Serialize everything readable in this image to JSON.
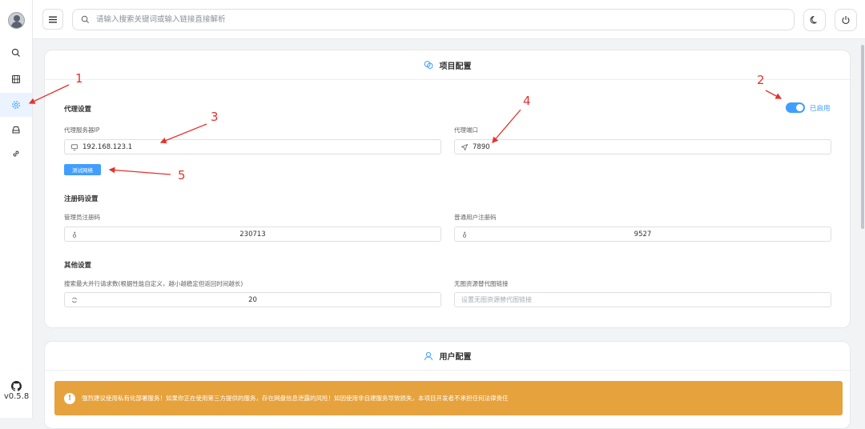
{
  "header": {
    "search_placeholder": "请输入搜索关键词或输入链接直接解析"
  },
  "sidebar": {
    "items": [
      {
        "icon": "search-icon"
      },
      {
        "icon": "film-icon"
      },
      {
        "icon": "gear-icon",
        "active": true
      },
      {
        "icon": "drive-icon"
      },
      {
        "icon": "link-icon"
      }
    ],
    "version": "v0.5.8"
  },
  "project_config": {
    "title": "项目配置",
    "proxy": {
      "section_title": "代理设置",
      "enabled_label": "已启用",
      "enabled": true,
      "ip_label": "代理服务器IP",
      "ip_value": "192.168.123.1",
      "port_label": "代理端口",
      "port_value": "7890",
      "test_button": "测试网络"
    },
    "register": {
      "section_title": "注册码设置",
      "admin_label": "管理员注册码",
      "admin_value": "230713",
      "user_label": "普通用户注册码",
      "user_value": "9527"
    },
    "other": {
      "section_title": "其他设置",
      "concurrency_label": "搜索最大并行请求数(根据性能自定义，越小越稳定但返回时间越长)",
      "concurrency_value": "20",
      "image_proxy_label": "无图资源替代图链接",
      "image_proxy_placeholder": "设置无图资源替代图链接"
    }
  },
  "user_config": {
    "title": "用户配置",
    "alert_icon": "!",
    "alert_text": "强烈建议使用私有化部署服务！如果你正在使用第三方提供的服务，存在网盘信息泄露的风险！如因使用非自建服务导致损失，本项目开发者不承担任何法律责任"
  },
  "annotations": [
    "1",
    "2",
    "3",
    "4",
    "5"
  ],
  "colors": {
    "accent": "#409eff",
    "warning": "#e6a23c",
    "annotation": "#e5322d"
  }
}
